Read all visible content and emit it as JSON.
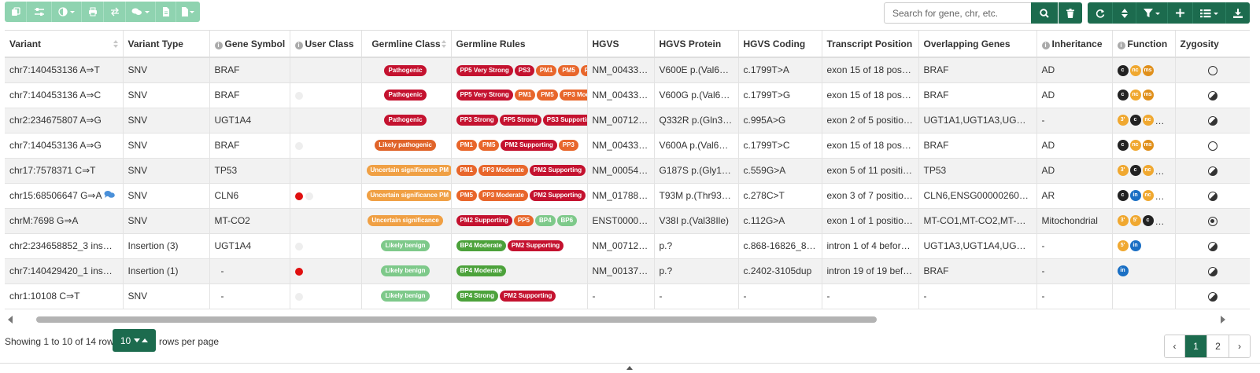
{
  "colors": {
    "primary": "#1c6b4e",
    "primary_light": "#8fd3b0",
    "pathogenic": "#c4122f",
    "likely_pathogenic": "#e0642a",
    "uncertain": "#f0a044",
    "likely_benign": "#7ec98a",
    "rule_red": "#c4122f",
    "rule_orange": "#e8662b",
    "rule_green": "#4ca23b",
    "rule_lightgreen": "#7ec98a"
  },
  "toolbar": {
    "left_icons": [
      "copy-icon",
      "sliders-icon",
      "contrast-dropdown-icon",
      "print-icon",
      "swap-icon",
      "comments-dropdown-icon",
      "file-icon",
      "file-dropdown-icon"
    ],
    "search_placeholder": "Search for gene, chr, etc.",
    "search_icon": "search-icon",
    "clear_icon": "trash-icon",
    "right_icons": [
      "refresh-icon",
      "sort-icon",
      "filter-dropdown-icon",
      "plus-icon",
      "columns-dropdown-icon",
      "download-icon"
    ]
  },
  "table": {
    "columns": [
      {
        "label": "Variant",
        "info": false,
        "sort": true
      },
      {
        "label": "Variant Type",
        "info": false,
        "sort": false
      },
      {
        "label": "Gene Symbol",
        "info": true,
        "sort": false
      },
      {
        "label": "User Class",
        "info": true,
        "sort": false
      },
      {
        "label": "Germline Class",
        "info": false,
        "sort": true,
        "center": true
      },
      {
        "label": "Germline Rules",
        "info": false,
        "sort": false
      },
      {
        "label": "HGVS",
        "info": false,
        "sort": false
      },
      {
        "label": "HGVS Protein",
        "info": false,
        "sort": false
      },
      {
        "label": "HGVS Coding",
        "info": false,
        "sort": false
      },
      {
        "label": "Transcript Position",
        "info": false,
        "sort": false
      },
      {
        "label": "Overlapping Genes",
        "info": false,
        "sort": false
      },
      {
        "label": "Inheritance",
        "info": true,
        "sort": false
      },
      {
        "label": "Function",
        "info": true,
        "sort": false
      },
      {
        "label": "Zygosity",
        "info": false,
        "sort": false
      }
    ],
    "rows": [
      {
        "variant": "chr7:140453136 A⇒T",
        "comment": false,
        "type": "SNV",
        "gene": "BRAF",
        "user_class": [],
        "germline_class": {
          "label": "Pathogenic",
          "color": "#c4122f"
        },
        "rules": [
          {
            "label": "PP5 Very Strong",
            "color": "#c4122f"
          },
          {
            "label": "PS3",
            "color": "#c4122f"
          },
          {
            "label": "PM1",
            "color": "#e8662b"
          },
          {
            "label": "PM5",
            "color": "#e8662b"
          },
          {
            "label": "PP3 Moderate",
            "color": "#e8662b"
          }
        ],
        "hgvs": "NM_004333.4:c.1799T>A",
        "protein": "V600E p.(Val600Glu)",
        "coding": "c.1799T>A",
        "tpos": "exon 15 of 18 position 1799",
        "overlap": "BRAF",
        "inheritance": "AD",
        "function": [
          {
            "t": "c",
            "c": "#222222"
          },
          {
            "t": "nc",
            "c": "#f0a830"
          },
          {
            "t": "ms",
            "c": "#e0901c"
          }
        ],
        "function_more": false,
        "zygosity": "hom-ref"
      },
      {
        "variant": "chr7:140453136 A⇒C",
        "comment": false,
        "type": "SNV",
        "gene": "BRAF",
        "user_class": [
          "#eeeeee"
        ],
        "germline_class": {
          "label": "Pathogenic",
          "color": "#c4122f"
        },
        "rules": [
          {
            "label": "PP5 Very Strong",
            "color": "#c4122f"
          },
          {
            "label": "PM1",
            "color": "#e8662b"
          },
          {
            "label": "PM5",
            "color": "#e8662b"
          },
          {
            "label": "PP3 Moderate",
            "color": "#e8662b"
          }
        ],
        "hgvs": "NM_004333.4:c.1799T>G",
        "protein": "V600G p.(Val600Gly)",
        "coding": "c.1799T>G",
        "tpos": "exon 15 of 18 position 1799",
        "overlap": "BRAF",
        "inheritance": "AD",
        "function": [
          {
            "t": "c",
            "c": "#222222"
          },
          {
            "t": "nc",
            "c": "#f0a830"
          },
          {
            "t": "ms",
            "c": "#e0901c"
          }
        ],
        "function_more": false,
        "zygosity": "het"
      },
      {
        "variant": "chr2:234675807 A⇒G",
        "comment": false,
        "type": "SNV",
        "gene": "UGT1A4",
        "user_class": [],
        "germline_class": {
          "label": "Pathogenic",
          "color": "#c4122f"
        },
        "rules": [
          {
            "label": "PP3 Strong",
            "color": "#c4122f"
          },
          {
            "label": "PP5 Strong",
            "color": "#c4122f"
          },
          {
            "label": "PS3 Supporting",
            "color": "#c4122f"
          },
          {
            "label": "PM1",
            "color": "#e8662b"
          }
        ],
        "hgvs": "NM_007120.3:c.995A>G",
        "protein": "Q332R p.(Gln332Arg)",
        "coding": "c.995A>G",
        "tpos": "exon 2 of 5 position 995",
        "overlap": "UGT1A1,UGT1A3,UGT1A4",
        "inheritance": "-",
        "function": [
          {
            "t": "3'",
            "c": "#f0a830"
          },
          {
            "t": "c",
            "c": "#222222"
          },
          {
            "t": "nc",
            "c": "#f0a830"
          }
        ],
        "function_more": true,
        "zygosity": "het"
      },
      {
        "variant": "chr7:140453136 A⇒G",
        "comment": false,
        "type": "SNV",
        "gene": "BRAF",
        "user_class": [
          "#eeeeee"
        ],
        "germline_class": {
          "label": "Likely pathogenic",
          "color": "#e0642a"
        },
        "rules": [
          {
            "label": "PM1",
            "color": "#e8662b"
          },
          {
            "label": "PM5",
            "color": "#e8662b"
          },
          {
            "label": "PM2 Supporting",
            "color": "#c4122f"
          },
          {
            "label": "PP3",
            "color": "#e8662b"
          }
        ],
        "hgvs": "NM_004333.4:c.1799T>C",
        "protein": "V600A p.(Val600Ala)",
        "coding": "c.1799T>C",
        "tpos": "exon 15 of 18 position 1799",
        "overlap": "BRAF",
        "inheritance": "AD",
        "function": [
          {
            "t": "c",
            "c": "#222222"
          },
          {
            "t": "nc",
            "c": "#f0a830"
          },
          {
            "t": "ms",
            "c": "#e0901c"
          }
        ],
        "function_more": false,
        "zygosity": "hom-ref"
      },
      {
        "variant": "chr17:7578371 C⇒T",
        "comment": false,
        "type": "SNV",
        "gene": "TP53",
        "user_class": [],
        "germline_class": {
          "label": "Uncertain significance PM",
          "color": "#f0a044"
        },
        "rules": [
          {
            "label": "PM1",
            "color": "#e8662b"
          },
          {
            "label": "PP3 Moderate",
            "color": "#e8662b"
          },
          {
            "label": "PM2 Supporting",
            "color": "#c4122f"
          }
        ],
        "hgvs": "NM_000546.5:c.559G>A",
        "protein": "G187S p.(Gly187Ser)",
        "coding": "c.559G>A",
        "tpos": "exon 5 of 11 position 559",
        "overlap": "TP53",
        "inheritance": "AD",
        "function": [
          {
            "t": "3'",
            "c": "#f0a830"
          },
          {
            "t": "c",
            "c": "#222222"
          },
          {
            "t": "nc",
            "c": "#f0a830"
          }
        ],
        "function_more": true,
        "zygosity": "het"
      },
      {
        "variant": "chr15:68506647 G⇒A",
        "comment": true,
        "type": "SNV",
        "gene": "CLN6",
        "user_class": [
          "#e01010",
          "#eeeeee"
        ],
        "germline_class": {
          "label": "Uncertain significance PM",
          "color": "#f0a044"
        },
        "rules": [
          {
            "label": "PM5",
            "color": "#e8662b"
          },
          {
            "label": "PP3 Moderate",
            "color": "#e8662b"
          },
          {
            "label": "PM2 Supporting",
            "color": "#c4122f"
          }
        ],
        "hgvs": "NM_017882.3:c.278C>T",
        "protein": "T93M p.(Thr93Met)",
        "coding": "c.278C>T",
        "tpos": "exon 3 of 7 position 278",
        "overlap": "CLN6,ENSG00000260007",
        "inheritance": "AR",
        "function": [
          {
            "t": "c",
            "c": "#222222"
          },
          {
            "t": "in",
            "c": "#1a6fc4"
          },
          {
            "t": "nc",
            "c": "#f0a830"
          }
        ],
        "function_more": true,
        "zygosity": "het"
      },
      {
        "variant": "chrM:7698 G⇒A",
        "comment": false,
        "type": "SNV",
        "gene": "MT-CO2",
        "user_class": [],
        "germline_class": {
          "label": "Uncertain significance",
          "color": "#f0a044"
        },
        "rules": [
          {
            "label": "PM2 Supporting",
            "color": "#c4122f"
          },
          {
            "label": "PP5",
            "color": "#e8662b"
          },
          {
            "label": "BP4",
            "color": "#7ec98a"
          },
          {
            "label": "BP6",
            "color": "#7ec98a"
          }
        ],
        "hgvs": "ENST00000361739.1:c.112G>A",
        "protein": "V38I p.(Val38Ile)",
        "coding": "c.112G>A",
        "tpos": "exon 1 of 1 position 112",
        "overlap": "MT-CO1,MT-CO2,MT-TD,MT-TK",
        "inheritance": "Mitochondrial",
        "function": [
          {
            "t": "3'",
            "c": "#f0a830"
          },
          {
            "t": "5'",
            "c": "#f0a830"
          },
          {
            "t": "c",
            "c": "#222222"
          }
        ],
        "function_more": true,
        "zygosity": "hom"
      },
      {
        "variant": "chr2:234658852_3 insGTG",
        "comment": false,
        "type": "Insertion (3)",
        "gene": "UGT1A4",
        "user_class": [
          "#eeeeee"
        ],
        "germline_class": {
          "label": "Likely benign",
          "color": "#7ec98a"
        },
        "rules": [
          {
            "label": "BP4 Moderate",
            "color": "#4ca23b"
          },
          {
            "label": "PM2 Supporting",
            "color": "#c4122f"
          }
        ],
        "hgvs": "NM_007120.3:c.868-16826_868-16825insGTG",
        "protein": "p.?",
        "coding": "c.868-16826_868-16825insGTG",
        "tpos": "intron 1 of 4 before exon 2",
        "overlap": "UGT1A3,UGT1A4,UGT1A5",
        "inheritance": "-",
        "function": [
          {
            "t": "5'",
            "c": "#f0a830"
          },
          {
            "t": "in",
            "c": "#1a6fc4"
          }
        ],
        "function_more": false,
        "zygosity": "het"
      },
      {
        "variant": "chr7:140429420_1 insA",
        "comment": true,
        "type": "Insertion (1)",
        "gene": "-",
        "user_class": [
          "#e01010"
        ],
        "germline_class": {
          "label": "Likely benign",
          "color": "#7ec98a"
        },
        "rules": [
          {
            "label": "BP4 Moderate",
            "color": "#4ca23b"
          }
        ],
        "hgvs": "NM_001374258.1:c.2402-3105dup",
        "protein": "p.?",
        "coding": "c.2402-3105dup",
        "tpos": "intron 19 of 19 before exon 20",
        "overlap": "BRAF",
        "inheritance": "-",
        "function": [
          {
            "t": "in",
            "c": "#1a6fc4"
          }
        ],
        "function_more": false,
        "zygosity": "het"
      },
      {
        "variant": "chr1:10108 C⇒T",
        "comment": false,
        "type": "SNV",
        "gene": "-",
        "user_class": [
          "#eeeeee"
        ],
        "germline_class": {
          "label": "Likely benign",
          "color": "#7ec98a"
        },
        "rules": [
          {
            "label": "BP4 Strong",
            "color": "#4ca23b"
          },
          {
            "label": "PM2 Supporting",
            "color": "#c4122f"
          }
        ],
        "hgvs": "-",
        "protein": "-",
        "coding": "-",
        "tpos": "-",
        "overlap": "-",
        "inheritance": "-",
        "function": [],
        "function_more": false,
        "zygosity": "het"
      }
    ]
  },
  "footer": {
    "showing": "Showing 1 to 10 of 14 rows",
    "page_size": "10",
    "rows_per_page_label": "rows per page",
    "pages": [
      "‹",
      "1",
      "2",
      "›"
    ],
    "active_page": "1"
  }
}
